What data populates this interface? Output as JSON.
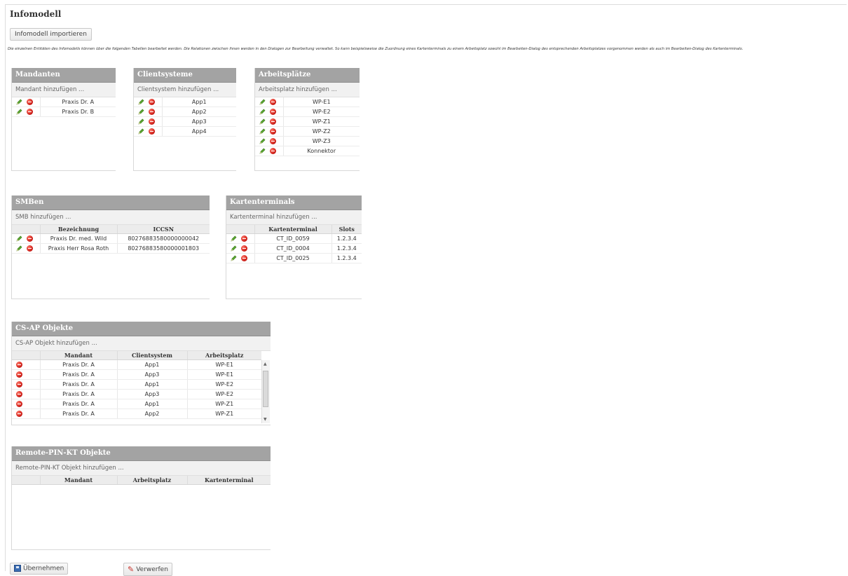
{
  "page": {
    "title": "Infomodell",
    "import_button": "Infomodell importieren",
    "description": "Die einzelnen Entitäten des Infomodells können über die folgenden Tabellen bearbeitet werden. Die Relationen zwischen ihnen werden in den Dialogen zur Bearbeitung verwaltet. So kann beispielsweise die Zuordnung eines Kartenterminals zu einem Arbeitsplatz sowohl im Bearbeiten-Dialog des entsprechenden Arbeitsplatzes vorgenommen werden als auch im Bearbeiten-Dialog des Kartenterminals.",
    "apply_button": "Übernehmen",
    "discard_button": "Verwerfen"
  },
  "icons": {
    "edit": "pencil-icon",
    "delete": "delete-icon",
    "save": "save-icon",
    "discard": "discard-icon"
  },
  "colors": {
    "panel_header": "#a3a3a3",
    "delete_red": "#d0201a",
    "edit_green": "#4a9a2a"
  },
  "mandanten": {
    "title": "Mandanten",
    "add": "Mandant hinzufügen ...",
    "rows": [
      "Praxis Dr. A",
      "Praxis Dr. B"
    ]
  },
  "clientsysteme": {
    "title": "Clientsysteme",
    "add": "Clientsystem hinzufügen ...",
    "rows": [
      "App1",
      "App2",
      "App3",
      "App4"
    ]
  },
  "arbeitsplaetze": {
    "title": "Arbeitsplätze",
    "add": "Arbeitsplatz hinzufügen ...",
    "rows": [
      "WP-E1",
      "WP-E2",
      "WP-Z1",
      "WP-Z2",
      "WP-Z3",
      "Konnektor"
    ]
  },
  "smben": {
    "title": "SMBen",
    "add": "SMB hinzufügen ...",
    "columns": [
      "Bezeichnung",
      "ICCSN"
    ],
    "rows": [
      [
        "Praxis Dr. med. Wild",
        "80276883580000000042"
      ],
      [
        "Praxis Herr Rosa Roth",
        "80276883580000001803"
      ]
    ]
  },
  "kartenterminals": {
    "title": "Kartenterminals",
    "add": "Kartenterminal hinzufügen ...",
    "columns": [
      "Kartenterminal",
      "Slots"
    ],
    "rows": [
      [
        "CT_ID_0059",
        "1.2.3.4"
      ],
      [
        "CT_ID_0004",
        "1.2.3.4"
      ],
      [
        "CT_ID_0025",
        "1.2.3.4"
      ]
    ]
  },
  "csap": {
    "title": "CS-AP Objekte",
    "add": "CS-AP Objekt hinzufügen ...",
    "columns": [
      "Mandant",
      "Clientsystem",
      "Arbeitsplatz"
    ],
    "rows": [
      [
        "Praxis Dr. A",
        "App1",
        "WP-E1"
      ],
      [
        "Praxis Dr. A",
        "App3",
        "WP-E1"
      ],
      [
        "Praxis Dr. A",
        "App1",
        "WP-E2"
      ],
      [
        "Praxis Dr. A",
        "App3",
        "WP-E2"
      ],
      [
        "Praxis Dr. A",
        "App1",
        "WP-Z1"
      ],
      [
        "Praxis Dr. A",
        "App2",
        "WP-Z1"
      ]
    ]
  },
  "remotepin": {
    "title": "Remote-PIN-KT Objekte",
    "add": "Remote-PIN-KT Objekt hinzufügen ...",
    "columns": [
      "Mandant",
      "Arbeitsplatz",
      "Kartenterminal"
    ]
  }
}
